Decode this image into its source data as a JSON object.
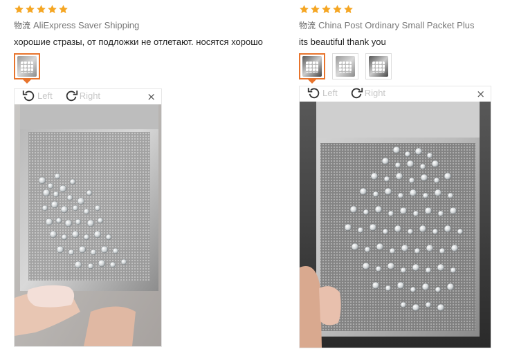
{
  "reviews": [
    {
      "rating": 5,
      "shipping_key": "物流",
      "shipping_method": "AliExpress Saver Shipping",
      "text": "хорошие стразы, от подложки не отлетают. носятся хорошо",
      "thumb_count": 1,
      "viewer": {
        "left_label": "Left",
        "right_label": "Right",
        "close_glyph": "×"
      }
    },
    {
      "rating": 5,
      "shipping_key": "物流",
      "shipping_method": "China Post Ordinary Small Packet Plus",
      "text": "its beautiful thank you",
      "thumb_count": 3,
      "viewer": {
        "left_label": "Left",
        "right_label": "Right",
        "close_glyph": "×"
      }
    }
  ],
  "colors": {
    "star": "#f5a623",
    "active_thumb": "#e8742c"
  },
  "icons": [
    "star-icon",
    "rotate-left-icon",
    "rotate-right-icon",
    "close-icon"
  ]
}
